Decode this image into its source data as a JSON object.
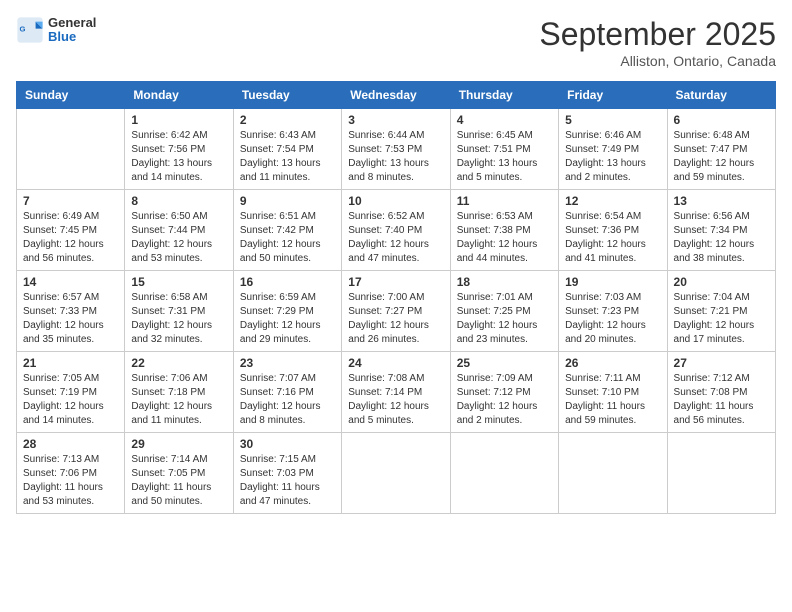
{
  "header": {
    "logo_line1": "General",
    "logo_line2": "Blue",
    "month": "September 2025",
    "location": "Alliston, Ontario, Canada"
  },
  "weekdays": [
    "Sunday",
    "Monday",
    "Tuesday",
    "Wednesday",
    "Thursday",
    "Friday",
    "Saturday"
  ],
  "weeks": [
    [
      {
        "day": "",
        "info": ""
      },
      {
        "day": "1",
        "info": "Sunrise: 6:42 AM\nSunset: 7:56 PM\nDaylight: 13 hours\nand 14 minutes."
      },
      {
        "day": "2",
        "info": "Sunrise: 6:43 AM\nSunset: 7:54 PM\nDaylight: 13 hours\nand 11 minutes."
      },
      {
        "day": "3",
        "info": "Sunrise: 6:44 AM\nSunset: 7:53 PM\nDaylight: 13 hours\nand 8 minutes."
      },
      {
        "day": "4",
        "info": "Sunrise: 6:45 AM\nSunset: 7:51 PM\nDaylight: 13 hours\nand 5 minutes."
      },
      {
        "day": "5",
        "info": "Sunrise: 6:46 AM\nSunset: 7:49 PM\nDaylight: 13 hours\nand 2 minutes."
      },
      {
        "day": "6",
        "info": "Sunrise: 6:48 AM\nSunset: 7:47 PM\nDaylight: 12 hours\nand 59 minutes."
      }
    ],
    [
      {
        "day": "7",
        "info": "Sunrise: 6:49 AM\nSunset: 7:45 PM\nDaylight: 12 hours\nand 56 minutes."
      },
      {
        "day": "8",
        "info": "Sunrise: 6:50 AM\nSunset: 7:44 PM\nDaylight: 12 hours\nand 53 minutes."
      },
      {
        "day": "9",
        "info": "Sunrise: 6:51 AM\nSunset: 7:42 PM\nDaylight: 12 hours\nand 50 minutes."
      },
      {
        "day": "10",
        "info": "Sunrise: 6:52 AM\nSunset: 7:40 PM\nDaylight: 12 hours\nand 47 minutes."
      },
      {
        "day": "11",
        "info": "Sunrise: 6:53 AM\nSunset: 7:38 PM\nDaylight: 12 hours\nand 44 minutes."
      },
      {
        "day": "12",
        "info": "Sunrise: 6:54 AM\nSunset: 7:36 PM\nDaylight: 12 hours\nand 41 minutes."
      },
      {
        "day": "13",
        "info": "Sunrise: 6:56 AM\nSunset: 7:34 PM\nDaylight: 12 hours\nand 38 minutes."
      }
    ],
    [
      {
        "day": "14",
        "info": "Sunrise: 6:57 AM\nSunset: 7:33 PM\nDaylight: 12 hours\nand 35 minutes."
      },
      {
        "day": "15",
        "info": "Sunrise: 6:58 AM\nSunset: 7:31 PM\nDaylight: 12 hours\nand 32 minutes."
      },
      {
        "day": "16",
        "info": "Sunrise: 6:59 AM\nSunset: 7:29 PM\nDaylight: 12 hours\nand 29 minutes."
      },
      {
        "day": "17",
        "info": "Sunrise: 7:00 AM\nSunset: 7:27 PM\nDaylight: 12 hours\nand 26 minutes."
      },
      {
        "day": "18",
        "info": "Sunrise: 7:01 AM\nSunset: 7:25 PM\nDaylight: 12 hours\nand 23 minutes."
      },
      {
        "day": "19",
        "info": "Sunrise: 7:03 AM\nSunset: 7:23 PM\nDaylight: 12 hours\nand 20 minutes."
      },
      {
        "day": "20",
        "info": "Sunrise: 7:04 AM\nSunset: 7:21 PM\nDaylight: 12 hours\nand 17 minutes."
      }
    ],
    [
      {
        "day": "21",
        "info": "Sunrise: 7:05 AM\nSunset: 7:19 PM\nDaylight: 12 hours\nand 14 minutes."
      },
      {
        "day": "22",
        "info": "Sunrise: 7:06 AM\nSunset: 7:18 PM\nDaylight: 12 hours\nand 11 minutes."
      },
      {
        "day": "23",
        "info": "Sunrise: 7:07 AM\nSunset: 7:16 PM\nDaylight: 12 hours\nand 8 minutes."
      },
      {
        "day": "24",
        "info": "Sunrise: 7:08 AM\nSunset: 7:14 PM\nDaylight: 12 hours\nand 5 minutes."
      },
      {
        "day": "25",
        "info": "Sunrise: 7:09 AM\nSunset: 7:12 PM\nDaylight: 12 hours\nand 2 minutes."
      },
      {
        "day": "26",
        "info": "Sunrise: 7:11 AM\nSunset: 7:10 PM\nDaylight: 11 hours\nand 59 minutes."
      },
      {
        "day": "27",
        "info": "Sunrise: 7:12 AM\nSunset: 7:08 PM\nDaylight: 11 hours\nand 56 minutes."
      }
    ],
    [
      {
        "day": "28",
        "info": "Sunrise: 7:13 AM\nSunset: 7:06 PM\nDaylight: 11 hours\nand 53 minutes."
      },
      {
        "day": "29",
        "info": "Sunrise: 7:14 AM\nSunset: 7:05 PM\nDaylight: 11 hours\nand 50 minutes."
      },
      {
        "day": "30",
        "info": "Sunrise: 7:15 AM\nSunset: 7:03 PM\nDaylight: 11 hours\nand 47 minutes."
      },
      {
        "day": "",
        "info": ""
      },
      {
        "day": "",
        "info": ""
      },
      {
        "day": "",
        "info": ""
      },
      {
        "day": "",
        "info": ""
      }
    ]
  ]
}
